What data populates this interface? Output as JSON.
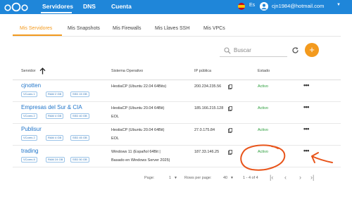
{
  "header": {
    "nav": [
      "Servidores",
      "DNS",
      "Cuenta"
    ],
    "lang": "Es",
    "email": "cjn1984@hotmail.com",
    "accent": "#1f86d9"
  },
  "tabs": [
    "Mis Servidores",
    "Mis Snapshots",
    "Mis Firewalls",
    "Mis Llaves SSH",
    "Mis VPCs"
  ],
  "search": {
    "placeholder": "Buscar"
  },
  "table": {
    "headers": [
      "Servidor",
      "Sistema Operativo",
      "IP pública",
      "Estado"
    ],
    "rows": [
      {
        "name": "cjnotten",
        "chips": [
          "VCores 1",
          "RAM 2 GB",
          "SSD 15 GB"
        ],
        "os": [
          "HestiaCP (Ubuntu 22.04 64Bits)"
        ],
        "ip": "200.234.235.56",
        "status": "Activo"
      },
      {
        "name": "Empresas del Sur & CIA",
        "chips": [
          "VCores 2",
          "RAM 4 GB",
          "SSD 40 GB"
        ],
        "os": [
          "HestiaCP (Ubuntu 20.04 64Bit)",
          "EOL"
        ],
        "ip": "185.166.215.128",
        "status": "Activo"
      },
      {
        "name": "Publisur",
        "chips": [
          "VCores 2",
          "RAM 4 GB",
          "SSD 45 GB"
        ],
        "os": [
          "HestiaCP (Ubuntu 20.04 64Bit)",
          "EOL"
        ],
        "ip": "27.0.175.84",
        "status": "Activo"
      },
      {
        "name": "trading",
        "chips": [
          "VCores 8",
          "RAM 24 GB",
          "SSD 50 GB"
        ],
        "os": [
          "Windows 11 (Español 64Bit |",
          "Basado en Windows Server 2025)"
        ],
        "ip": "187.33.146.25",
        "status": "Activo"
      }
    ]
  },
  "footer": {
    "page_label": "Page:",
    "page_value": "1",
    "rows_label": "Rows per page:",
    "rows_value": "40",
    "range": "1 - 4 of 4"
  },
  "colors": {
    "orange": "#f39a1e",
    "status_green": "#2a9d3a",
    "link_blue": "#1f74c9",
    "annotation": "#e8541a"
  }
}
